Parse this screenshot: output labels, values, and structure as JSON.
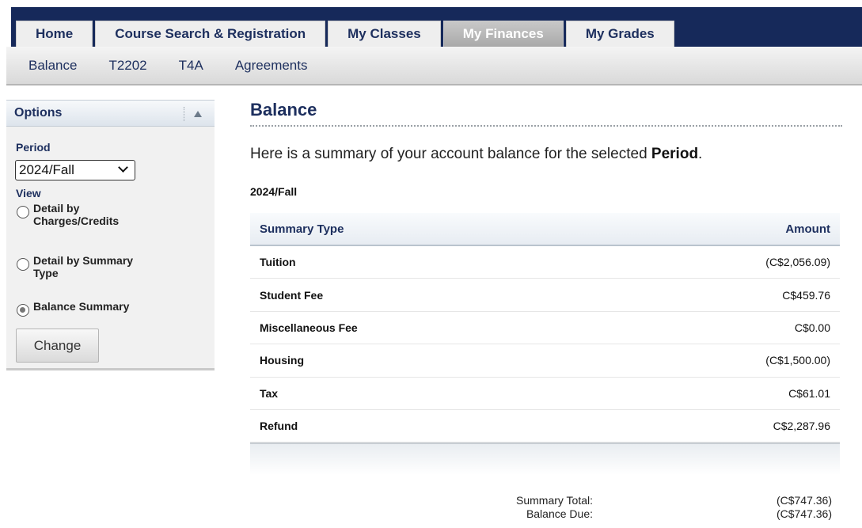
{
  "nav": {
    "main_tabs": [
      {
        "label": "Home"
      },
      {
        "label": "Course Search & Registration"
      },
      {
        "label": "My Classes"
      },
      {
        "label": "My Finances",
        "active": true
      },
      {
        "label": "My Grades"
      }
    ],
    "sub_tabs": [
      {
        "label": "Balance"
      },
      {
        "label": "T2202"
      },
      {
        "label": "T4A"
      },
      {
        "label": "Agreements"
      }
    ]
  },
  "options": {
    "title": "Options",
    "period_label": "Period",
    "period_value": "2024/Fall",
    "view_label": "View",
    "view_options": [
      {
        "label": "Detail by Charges/Credits",
        "checked": false
      },
      {
        "label": "Detail by Summary Type",
        "checked": false
      },
      {
        "label": "Balance Summary",
        "checked": true
      }
    ],
    "change_button": "Change"
  },
  "main": {
    "title": "Balance",
    "intro_text": "Here is a summary of your account balance for the selected ",
    "intro_bold": "Period",
    "intro_end": ".",
    "period_heading": "2024/Fall",
    "table": {
      "headers": {
        "type": "Summary Type",
        "amount": "Amount"
      },
      "rows": [
        {
          "type": "Tuition",
          "amount": "(C$2,056.09)"
        },
        {
          "type": "Student Fee",
          "amount": "C$459.76"
        },
        {
          "type": "Miscellaneous Fee",
          "amount": "C$0.00"
        },
        {
          "type": "Housing",
          "amount": "(C$1,500.00)"
        },
        {
          "type": "Tax",
          "amount": "C$61.01"
        },
        {
          "type": "Refund",
          "amount": "C$2,287.96"
        }
      ]
    },
    "summary_total_label": "Summary Total:",
    "summary_total_value": "(C$747.36)",
    "balance_due_label": "Balance Due:",
    "balance_due_value": "(C$747.36)"
  },
  "colors": {
    "nav_dark": "#16295a",
    "accent_text": "#1d2f5e",
    "active_tab": "#b5b5b5"
  }
}
